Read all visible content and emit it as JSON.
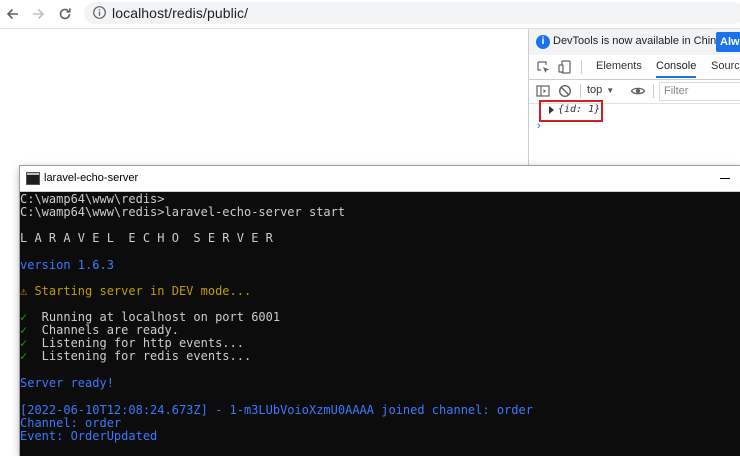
{
  "browser": {
    "url": "localhost/redis/public/",
    "icons": {
      "back": "arrow-left-icon",
      "forward": "arrow-right-icon",
      "reload": "reload-icon",
      "site_info": "info-circle-icon"
    }
  },
  "devtools": {
    "banner_message": "DevTools is now available in Chinese!",
    "banner_button": "Alw",
    "tabs": [
      "Elements",
      "Console",
      "Source"
    ],
    "active_tab": "Console",
    "context": "top",
    "filter_placeholder": "Filter",
    "log_entry": "{id: 1}",
    "prompt": "›",
    "colors": {
      "accent": "#1a73e8",
      "highlight_box": "#d21f26"
    }
  },
  "terminal": {
    "title": "laravel-echo-server",
    "lines": {
      "l1": "C:\\wamp64\\www\\redis>",
      "l2": "C:\\wamp64\\www\\redis>laravel-echo-server start",
      "l3": "L A R A V E L  E C H O  S E R V E R",
      "l4": "version 1.6.3",
      "l5": "⚠ Starting server in DEV mode...",
      "l6_check": "✓",
      "l6": "  Running at localhost on port 6001",
      "l7_check": "✓",
      "l7": "  Channels are ready.",
      "l8_check": "✓",
      "l8": "  Listening for http events...",
      "l9_check": "✓",
      "l9": "  Listening for redis events...",
      "l10": "Server ready!",
      "l11": "[2022-06-10T12:08:24.673Z] - 1-m3LUbVoioXzmU0AAAA joined channel: order",
      "l12": "Channel: order",
      "l13": "Event: OrderUpdated"
    },
    "colors": {
      "background": "#0c0c0c",
      "text": "#cccccc",
      "info": "#3b78ff",
      "warn": "#c19c00",
      "success": "#13a10e"
    }
  }
}
